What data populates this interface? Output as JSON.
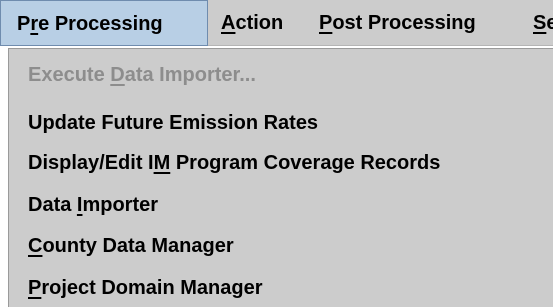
{
  "menubar": {
    "items": [
      {
        "pre": "P",
        "mnemonic": "r",
        "post": "e Processing",
        "active": true
      },
      {
        "pre": "",
        "mnemonic": "A",
        "post": "ction",
        "active": false
      },
      {
        "pre": "",
        "mnemonic": "P",
        "post": "ost Processing",
        "active": false
      },
      {
        "pre": "",
        "mnemonic": "S",
        "post": "e",
        "active": false
      }
    ]
  },
  "dropdown": {
    "items": [
      {
        "pre": "Execute ",
        "mnemonic": "D",
        "post": "ata Importer...",
        "disabled": true
      },
      {
        "pre": "Update Future Emission Rates",
        "mnemonic": "",
        "post": "",
        "disabled": false
      },
      {
        "pre": "Display/Edit I",
        "mnemonic": "M",
        "post": " Program Coverage Records",
        "disabled": false
      },
      {
        "pre": "Data ",
        "mnemonic": "I",
        "post": "mporter",
        "disabled": false
      },
      {
        "pre": "",
        "mnemonic": "C",
        "post": "ounty Data Manager",
        "disabled": false
      },
      {
        "pre": "",
        "mnemonic": "P",
        "post": "roject Domain Manager",
        "disabled": false
      }
    ]
  }
}
